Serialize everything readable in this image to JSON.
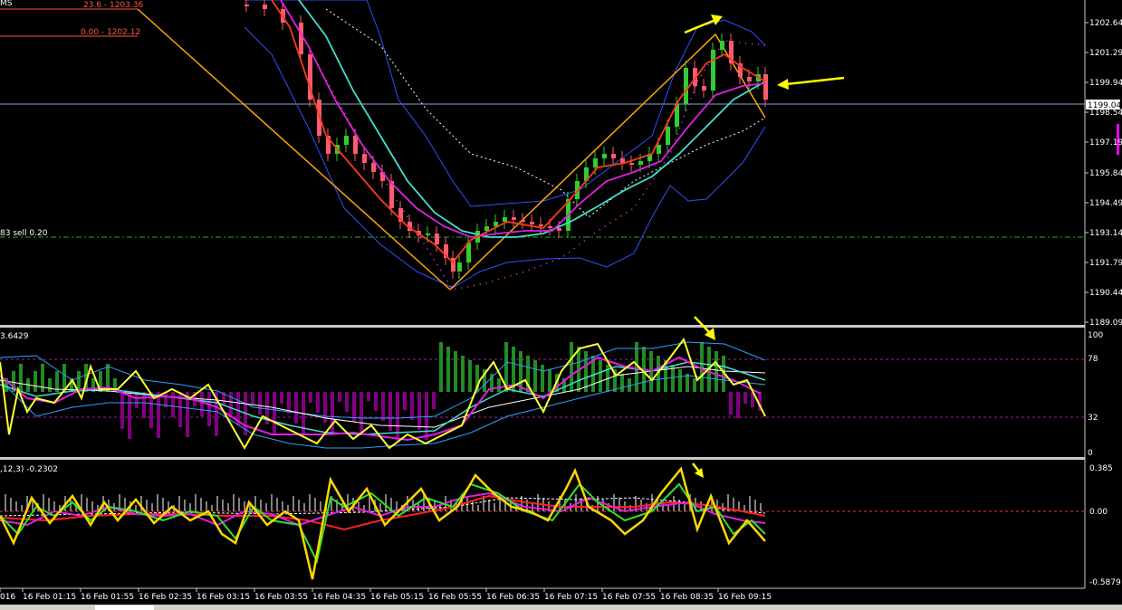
{
  "fib_levels": [
    {
      "label": "23.6 - 1203.36"
    },
    {
      "label": "0.00 - 1202.12"
    }
  ],
  "window_caption_fragment": "MS",
  "order_line_label": "83 sell 0.20",
  "price_axis": {
    "ticks": [
      "1202.64",
      "1201.29",
      "1199.94",
      "1198.54",
      "1197.19",
      "1195.84",
      "1194.49",
      "1193.14",
      "1191.79",
      "1190.44",
      "1189.09"
    ],
    "current_price": "1199.04"
  },
  "stoch_panel": {
    "title": "3.6429",
    "ticks": [
      "100",
      "78",
      "32",
      "0"
    ]
  },
  "macd_panel": {
    "title": ",12,3) -0.2302",
    "ticks": [
      "0.385",
      "0.00",
      "-0.5879"
    ]
  },
  "time_axis": {
    "labels": [
      "016",
      "16 Feb 01:15",
      "16 Feb 01:55",
      "16 Feb 02:35",
      "16 Feb 03:15",
      "16 Feb 03:55",
      "16 Feb 04:35",
      "16 Feb 05:15",
      "16 Feb 05:55",
      "16 Feb 06:35",
      "16 Feb 07:15",
      "16 Feb 07:55",
      "16 Feb 08:35",
      "16 Feb 09:15"
    ]
  },
  "colors": {
    "background": "#000000",
    "bull": "#32cd32",
    "bear": "#ff5a6e",
    "ma_fast": "#ff3a1a",
    "ma_slow": "#e020e0",
    "ma_cyan": "#40e0d0",
    "band": "#3050ff",
    "trend": "#ffa500",
    "arrow": "#ffff00"
  }
}
